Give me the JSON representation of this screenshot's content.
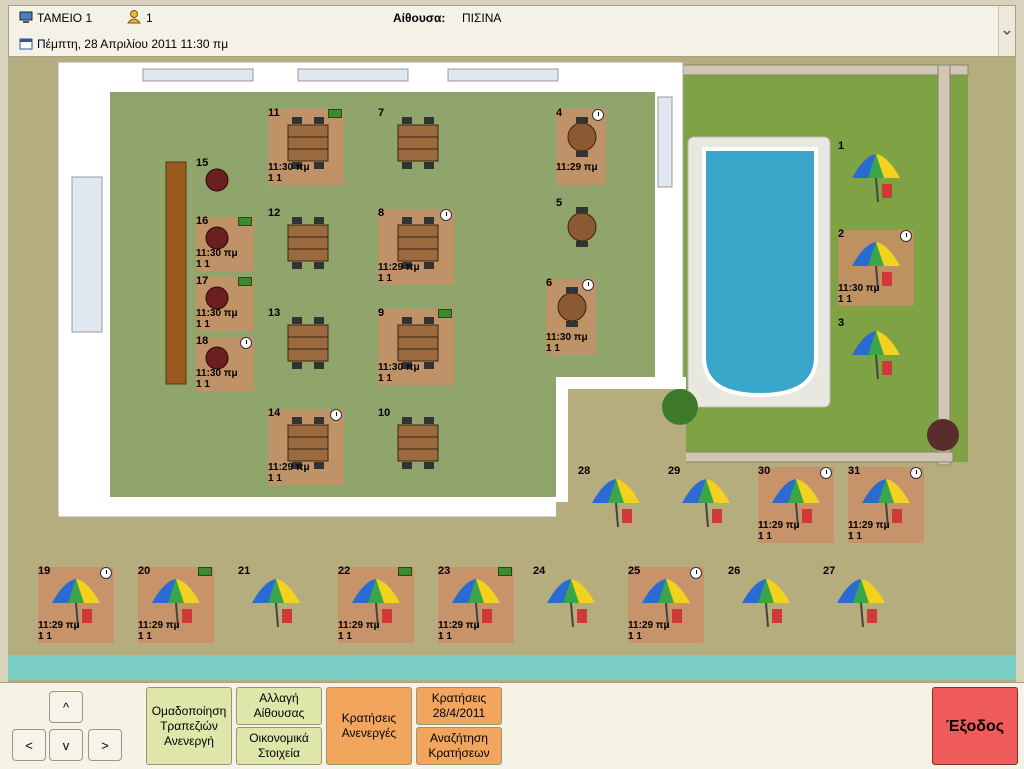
{
  "header": {
    "terminal": "ΤΑΜΕΙΟ 1",
    "user_count": "1",
    "room_label": "Αίθουσα:",
    "room_value": "ΠΙΣΙΝΑ",
    "datetime": "Πέμπτη, 28 Απριλίου 2011 11:30 πμ"
  },
  "tables": [
    {
      "num": "1",
      "icon": "umbrella",
      "time": "",
      "count": "",
      "status": ""
    },
    {
      "num": "2",
      "icon": "umbrella",
      "time": "11:30 πμ",
      "count": "1 1",
      "status": "clock"
    },
    {
      "num": "3",
      "icon": "umbrella",
      "time": "",
      "count": "",
      "status": ""
    },
    {
      "num": "4",
      "icon": "round-table",
      "time": "11:29 πμ",
      "count": "",
      "status": "clock"
    },
    {
      "num": "5",
      "icon": "round-table",
      "time": "",
      "count": "",
      "status": ""
    },
    {
      "num": "6",
      "icon": "round-table",
      "time": "11:30 πμ",
      "count": "1 1",
      "status": "clock"
    },
    {
      "num": "7",
      "icon": "square-table",
      "time": "",
      "count": "",
      "status": ""
    },
    {
      "num": "8",
      "icon": "square-table",
      "time": "11:29 πμ",
      "count": "1 1",
      "status": "clock"
    },
    {
      "num": "9",
      "icon": "square-table",
      "time": "11:30 πμ",
      "count": "1 1",
      "status": "cash"
    },
    {
      "num": "10",
      "icon": "square-table",
      "time": "",
      "count": "",
      "status": ""
    },
    {
      "num": "11",
      "icon": "square-table",
      "time": "11:30 πμ",
      "count": "1 1",
      "status": "cash"
    },
    {
      "num": "12",
      "icon": "square-table",
      "time": "",
      "count": "",
      "status": ""
    },
    {
      "num": "13",
      "icon": "square-table",
      "time": "",
      "count": "",
      "status": ""
    },
    {
      "num": "14",
      "icon": "square-table",
      "time": "11:29 πμ",
      "count": "1 1",
      "status": "clock"
    },
    {
      "num": "15",
      "icon": "stool",
      "time": "",
      "count": "",
      "status": ""
    },
    {
      "num": "16",
      "icon": "stool",
      "time": "11:30 πμ",
      "count": "1 1",
      "status": "cash"
    },
    {
      "num": "17",
      "icon": "stool",
      "time": "11:30 πμ",
      "count": "1 1",
      "status": "cash"
    },
    {
      "num": "18",
      "icon": "stool",
      "time": "11:30 πμ",
      "count": "1 1",
      "status": "clock"
    },
    {
      "num": "19",
      "icon": "umbrella",
      "time": "11:29 πμ",
      "count": "1 1",
      "status": "clock"
    },
    {
      "num": "20",
      "icon": "umbrella",
      "time": "11:29 πμ",
      "count": "1 1",
      "status": "cash"
    },
    {
      "num": "21",
      "icon": "umbrella",
      "time": "",
      "count": "",
      "status": ""
    },
    {
      "num": "22",
      "icon": "umbrella",
      "time": "11:29 πμ",
      "count": "1 1",
      "status": "cash"
    },
    {
      "num": "23",
      "icon": "umbrella",
      "time": "11:29 πμ",
      "count": "1 1",
      "status": "cash"
    },
    {
      "num": "24",
      "icon": "umbrella",
      "time": "",
      "count": "",
      "status": ""
    },
    {
      "num": "25",
      "icon": "umbrella",
      "time": "11:29 πμ",
      "count": "1 1",
      "status": "clock"
    },
    {
      "num": "26",
      "icon": "umbrella",
      "time": "",
      "count": "",
      "status": ""
    },
    {
      "num": "27",
      "icon": "umbrella",
      "time": "",
      "count": "",
      "status": ""
    },
    {
      "num": "28",
      "icon": "umbrella",
      "time": "",
      "count": "",
      "status": ""
    },
    {
      "num": "29",
      "icon": "umbrella",
      "time": "",
      "count": "",
      "status": ""
    },
    {
      "num": "30",
      "icon": "umbrella",
      "time": "11:29 πμ",
      "count": "1 1",
      "status": "clock"
    },
    {
      "num": "31",
      "icon": "umbrella",
      "time": "11:29 πμ",
      "count": "1 1",
      "status": "clock"
    }
  ],
  "nav": {
    "up": "^",
    "down": "v",
    "left": "<",
    "right": ">"
  },
  "buttons": {
    "group_tables": "Ομαδοποίηση\nΤραπεζιών\nΑνενεργή",
    "change_room": "Αλλαγή\nΑίθουσας",
    "financials": "Οικονομικά\nΣτοιχεία",
    "reservations_inactive": "Κρατήσεις\nΑνενεργές",
    "reservations_date": "Κρατήσεις\n28/4/2011",
    "search_reservations": "Αναζήτηση\nΚρατήσεων",
    "exit": "Έξοδος"
  },
  "colors": {
    "occupied": "#c98e66",
    "button_green": "#dfe6a9",
    "button_orange": "#f2a55d",
    "exit_red": "#ef5b5b",
    "pool": "#3aa6c9",
    "grass": "#7ea244"
  }
}
